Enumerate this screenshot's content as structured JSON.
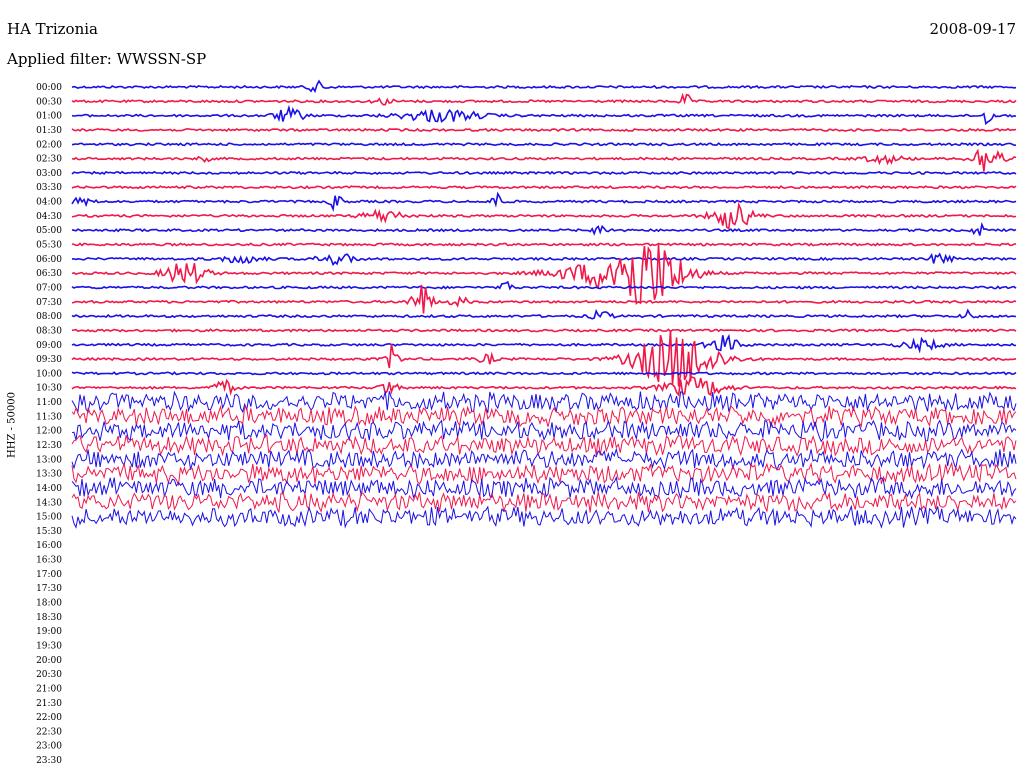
{
  "header": {
    "station": "HA Trizonia",
    "date": "2008-09-17",
    "filter": "Applied filter: WWSSN-SP"
  },
  "colors": {
    "blue_trace": "#1a10e6",
    "red_trace": "#f0184a",
    "background": "#ffffff"
  },
  "chart_data": {
    "type": "seismogram",
    "ylabel": "HHZ - 50000",
    "time_labels": [
      "00:00",
      "00:30",
      "01:00",
      "01:30",
      "02:00",
      "02:30",
      "03:00",
      "03:30",
      "04:00",
      "04:30",
      "05:00",
      "05:30",
      "06:00",
      "06:30",
      "07:00",
      "07:30",
      "08:00",
      "08:30",
      "09:00",
      "09:30",
      "10:00",
      "10:30",
      "11:00",
      "11:30",
      "12:00",
      "12:30",
      "13:00",
      "13:30",
      "14:00",
      "14:30",
      "15:00",
      "15:30",
      "16:00",
      "16:30",
      "17:00",
      "17:30",
      "18:00",
      "18:30",
      "19:00",
      "19:30",
      "20:00",
      "20:30",
      "21:00",
      "21:30",
      "22:00",
      "22:30",
      "23:00",
      "23:30"
    ],
    "trace_colors": [
      "blue",
      "red"
    ],
    "recorded_until_row": "15:00",
    "noisy_from_row": "11:00",
    "events": [
      {
        "row": "00:00",
        "x": 0.26,
        "amp": 5,
        "w": 0.01
      },
      {
        "row": "00:30",
        "x": 0.33,
        "amp": 3,
        "w": 0.01
      },
      {
        "row": "00:30",
        "x": 0.65,
        "amp": 8,
        "w": 0.005
      },
      {
        "row": "01:00",
        "x": 0.23,
        "amp": 7,
        "w": 0.015
      },
      {
        "row": "01:00",
        "x": 0.39,
        "amp": 6,
        "w": 0.04
      },
      {
        "row": "01:00",
        "x": 0.97,
        "amp": 10,
        "w": 0.005
      },
      {
        "row": "02:30",
        "x": 0.14,
        "amp": 4,
        "w": 0.005
      },
      {
        "row": "02:30",
        "x": 0.86,
        "amp": 4,
        "w": 0.02
      },
      {
        "row": "02:30",
        "x": 0.97,
        "amp": 16,
        "w": 0.015
      },
      {
        "row": "04:00",
        "x": 0.01,
        "amp": 4,
        "w": 0.01
      },
      {
        "row": "04:00",
        "x": 0.28,
        "amp": 9,
        "w": 0.006
      },
      {
        "row": "04:00",
        "x": 0.45,
        "amp": 9,
        "w": 0.006
      },
      {
        "row": "04:30",
        "x": 0.33,
        "amp": 6,
        "w": 0.02
      },
      {
        "row": "04:30",
        "x": 0.7,
        "amp": 13,
        "w": 0.02
      },
      {
        "row": "05:00",
        "x": 0.56,
        "amp": 4,
        "w": 0.01
      },
      {
        "row": "05:00",
        "x": 0.96,
        "amp": 9,
        "w": 0.005
      },
      {
        "row": "06:00",
        "x": 0.18,
        "amp": 4,
        "w": 0.02
      },
      {
        "row": "06:00",
        "x": 0.28,
        "amp": 5,
        "w": 0.02
      },
      {
        "row": "06:00",
        "x": 0.92,
        "amp": 7,
        "w": 0.01
      },
      {
        "row": "06:30",
        "x": 0.12,
        "amp": 12,
        "w": 0.02
      },
      {
        "row": "06:30",
        "x": 0.605,
        "amp": 38,
        "w": 0.04
      },
      {
        "row": "06:30",
        "x": 0.54,
        "amp": 6,
        "w": 0.04
      },
      {
        "row": "07:00",
        "x": 0.46,
        "amp": 14,
        "w": 0.004
      },
      {
        "row": "07:30",
        "x": 0.37,
        "amp": 18,
        "w": 0.01
      },
      {
        "row": "07:30",
        "x": 0.41,
        "amp": 6,
        "w": 0.008
      },
      {
        "row": "08:00",
        "x": 0.56,
        "amp": 5,
        "w": 0.01
      },
      {
        "row": "08:00",
        "x": 0.95,
        "amp": 6,
        "w": 0.006
      },
      {
        "row": "09:00",
        "x": 0.69,
        "amp": 9,
        "w": 0.015
      },
      {
        "row": "09:00",
        "x": 0.9,
        "amp": 5,
        "w": 0.02
      },
      {
        "row": "09:30",
        "x": 0.34,
        "amp": 16,
        "w": 0.006
      },
      {
        "row": "09:30",
        "x": 0.44,
        "amp": 5,
        "w": 0.008
      },
      {
        "row": "09:30",
        "x": 0.64,
        "amp": 30,
        "w": 0.04
      },
      {
        "row": "10:30",
        "x": 0.16,
        "amp": 8,
        "w": 0.01
      },
      {
        "row": "10:30",
        "x": 0.335,
        "amp": 9,
        "w": 0.008
      },
      {
        "row": "10:30",
        "x": 0.66,
        "amp": 10,
        "w": 0.03
      }
    ]
  }
}
